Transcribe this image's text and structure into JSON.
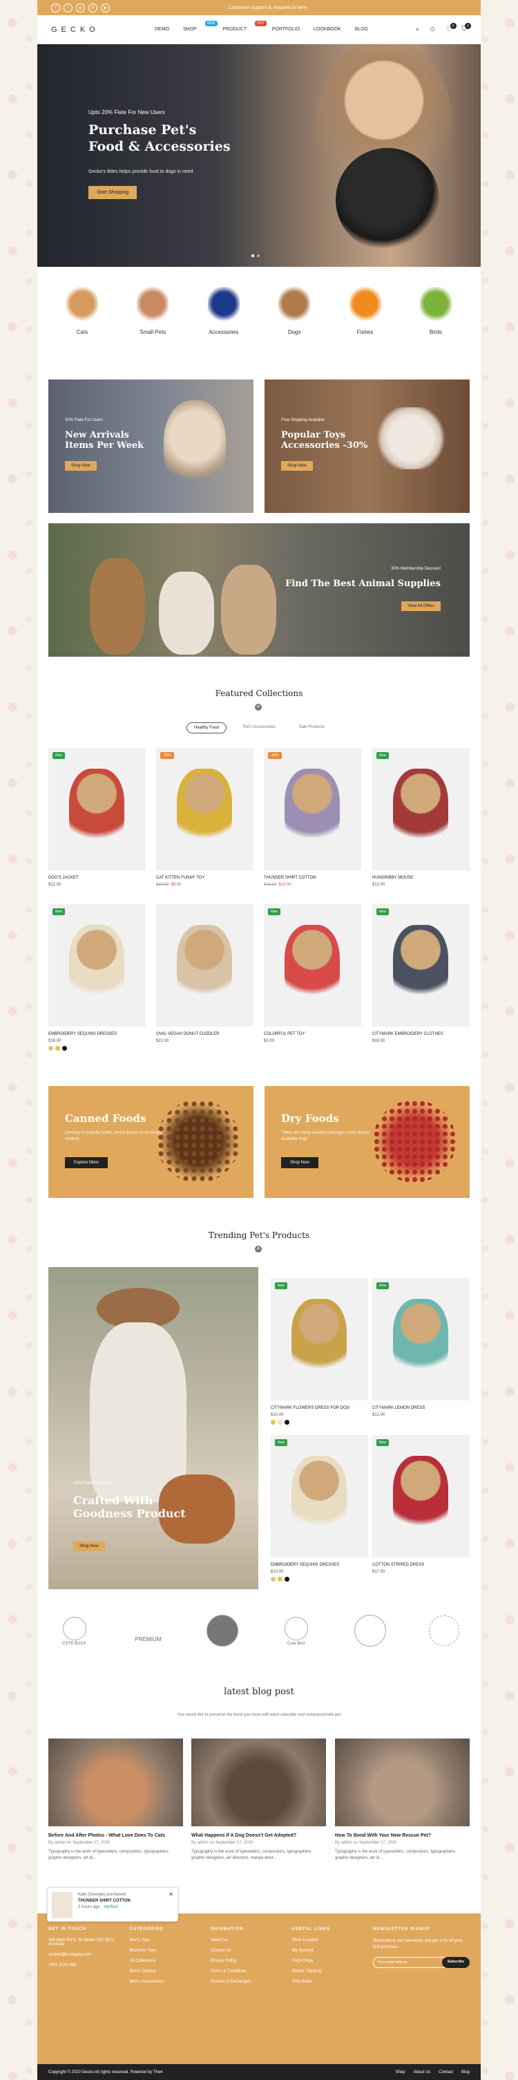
{
  "topbar": {
    "message": "Customer support is ensured in here",
    "social": [
      "f",
      "t",
      "◎",
      "p",
      "▶"
    ]
  },
  "nav": {
    "logo": "GECKO",
    "menu": [
      {
        "label": "DEMO"
      },
      {
        "label": "SHOP",
        "badge": "NEW"
      },
      {
        "label": "PRODUCT",
        "badge": "HOT"
      },
      {
        "label": "PORTFOLIO"
      },
      {
        "label": "LOOKBOOK"
      },
      {
        "label": "BLOG"
      }
    ],
    "wishlist_count": "0",
    "cart_count": "0"
  },
  "hero": {
    "subtitle": "Upto 20% Flate For New Users",
    "title_line1": "Purchase Pet's",
    "title_line2": "Food & Accessories",
    "description": "Gecko's Bites helps provide food to dogs in need",
    "button": "Start Shopping"
  },
  "categories": [
    {
      "label": "Cats",
      "color": "#d59b5d"
    },
    {
      "label": "Small Pets",
      "color": "#c98a62"
    },
    {
      "label": "Accessories",
      "color": "#1f3a8a"
    },
    {
      "label": "Dogs",
      "color": "#b07a4a"
    },
    {
      "label": "Fishes",
      "color": "#f08a1c"
    },
    {
      "label": "Birds",
      "color": "#7bb23a"
    }
  ],
  "promo1": {
    "small": "30% Flate For Users",
    "title_line1": "New Arrivals",
    "title_line2": "Items Per Week",
    "button": "Shop Now"
  },
  "promo2": {
    "small": "Free Shipping Available",
    "title_line1": "Popular Toys",
    "title_line2": "Accessories -30%",
    "button": "Shop Now"
  },
  "promo3": {
    "small": "30% Membership Discount",
    "title": "Find The Best Animal Supplies",
    "button": "View All Offers"
  },
  "featured": {
    "title": "Featured Collections",
    "tabs": [
      "Healthy Food",
      "Pet's Accessories",
      "Sale Products"
    ],
    "active_tab": "Healthy Food"
  },
  "products": [
    {
      "name": "DOG'S JACKET",
      "price": "$12.00",
      "tag": "New",
      "tag_color": "#2e9e4a",
      "img_color": "#c94a3b"
    },
    {
      "name": "CAT KITTEN FUNNY TOY",
      "old": "$10.00",
      "price": "$8.00",
      "tag": "-20%",
      "tag_color": "#e98a3a",
      "img_color": "#d9b23c"
    },
    {
      "name": "THUNDER SHIRT COTTON",
      "old": "$15.00",
      "price": "$12.00",
      "tag": "-20%",
      "tag_color": "#e98a3a",
      "img_color": "#9c8fb3"
    },
    {
      "name": "HUNGRIBBY MOUSE",
      "price": "$12.00",
      "tag": "New",
      "tag_color": "#2e9e4a",
      "img_color": "#a23a3a"
    },
    {
      "name": "EMBROIDERY SEQUINS DRESSES",
      "price": "$16.00",
      "tag": "New",
      "tag_color": "#2e9e4a",
      "img_color": "#e8dcc2",
      "swatches": [
        "#d8c88f",
        "#e7c53e",
        "#111"
      ]
    },
    {
      "name": "OVAL VEGAN DONUT CUDDLER",
      "price": "$22.00",
      "tag": "",
      "tag_color": "",
      "img_color": "#d8c3a6"
    },
    {
      "name": "COLORFUL PET TOY",
      "price": "$3.00",
      "tag": "New",
      "tag_color": "#2e9e4a",
      "img_color": "#d84a4a"
    },
    {
      "name": "CITYMARK EMBROIDERY CLOTHES",
      "price": "$16.00",
      "tag": "New",
      "tag_color": "#2e9e4a",
      "img_color": "#4b5160"
    }
  ],
  "food1": {
    "title": "Canned Foods",
    "text": "Contrary to popular belief, Lorem Ipsum is not simply random.",
    "button": "Explore More"
  },
  "food2": {
    "title": "Dry Foods",
    "text": "There are many variation passage Lorem Ipsum available majo",
    "button": "Shop Now"
  },
  "trending": {
    "title": "Trending Pet's Products",
    "promo_small": "20% Flate For Users",
    "promo_title_line1": "Crafted With",
    "promo_title_line2": "Goodness Product",
    "promo_button": "Shop Now"
  },
  "trend_products": [
    {
      "name": "CITYMARK FLOWERS DRESS FOR DOG",
      "price": "$10.00",
      "tag": "New",
      "img_color": "#c9a24a",
      "swatches": [
        "#e7c53e",
        "#e8e0c8",
        "#111"
      ]
    },
    {
      "name": "CITYMARK LEMON DRESS",
      "price": "$12.00",
      "tag": "New",
      "img_color": "#6fb6b0"
    },
    {
      "name": "EMBROIDERY SEQUINS DRESSES",
      "price": "$10.00",
      "tag": "New",
      "img_color": "#e8dcc2",
      "swatches": [
        "#d8c88f",
        "#e7c53e",
        "#111"
      ]
    },
    {
      "name": "COTTON STRIPED DRESS",
      "price": "$17.00",
      "tag": "New",
      "img_color": "#b82f3a"
    }
  ],
  "brands": [
    "CUTE BUCK",
    "PREMIUM",
    "",
    "Cute Bird",
    "",
    ""
  ],
  "blog": {
    "title": "latest blog post",
    "subtitle": "You would like to preserve the bond you have with each adorable and compassionate pet",
    "posts": [
      {
        "title": "Before And After Photos - What Love Does To Cats",
        "meta": "By admin on September 17, 2020",
        "excerpt": "Typography is the work of typesetters, compositors, typographers, graphic designers, art di...",
        "img_color": "#c98e64"
      },
      {
        "title": "What Happens If A Dog Doesn't Get Adopted?",
        "meta": "By admin on September 17, 2020",
        "excerpt": "Typography is the work of typesetters, compositors, typographers, graphic designers, art directors, manga artist...",
        "img_color": "#5d4a3c"
      },
      {
        "title": "How To Bond With Your New Rescue Pet?",
        "meta": "By admin on September 17, 2020",
        "excerpt": "Typography is the work of typesetters, compositors, typographers, graphic designers, art di...",
        "img_color": "#b49a84"
      }
    ]
  },
  "footer": {
    "cols": [
      {
        "h": "GET IN TOUCH",
        "items": [
          "184 Main Rd E, St Albans VIC 3021, Australia",
          "contact@company.com",
          "+001 2233 456"
        ]
      },
      {
        "h": "CATEGORIES",
        "items": [
          "Men's Toys",
          "Women's Toys",
          "All Collections",
          "Men's Clothes",
          "Men's Accessories"
        ]
      },
      {
        "h": "INFOMATION",
        "items": [
          "About Us",
          "Contact Us",
          "Privacy Policy",
          "Terms & Conditions",
          "Returns & Exchanges"
        ]
      },
      {
        "h": "USEFUL LINKS",
        "items": [
          "Store Location",
          "My Account",
          "FAQs Page",
          "Orders Tracking",
          "Size Guide"
        ]
      }
    ],
    "newsletter": {
      "h": "NEWSLETTER SIGNUP",
      "text": "Subscribe to our newsletter and get 10% off your first purchase",
      "placeholder": "Your email address",
      "button": "Subscribe"
    }
  },
  "copyright": {
    "text": "Copyright © 2020 Gecko All rights reserved. Powered by The4",
    "links": [
      "Shop",
      "About Us",
      "Contact",
      "Blog"
    ]
  },
  "popup": {
    "name": "Kate (Georgia) purchased",
    "product": "THUNDER SHIRT COTTON",
    "time": "2 hours ago",
    "verified": "Verified"
  }
}
